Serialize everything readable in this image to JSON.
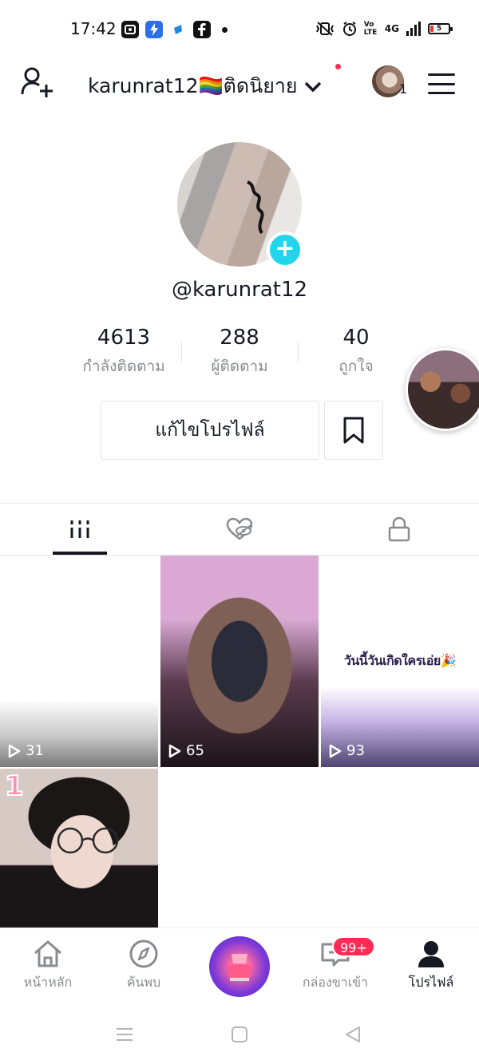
{
  "status_bar": {
    "time": "17:42",
    "left_icons": [
      "screen-record-icon",
      "lightning-app-icon",
      "shield-app-icon",
      "facebook-icon",
      "dot-icon"
    ],
    "right_icons": [
      "vibrate-icon",
      "alarm-icon",
      "volte-icon",
      "4g-signal-icon",
      "battery-icon"
    ],
    "volte_text": "Vo LTE",
    "network_text": "4G",
    "battery_level": "5"
  },
  "header": {
    "username": "karunrat12🏳️‍🌈ติดนิยาย",
    "account_count": "1"
  },
  "profile": {
    "handle": "@karunrat12",
    "stats": [
      {
        "value": "4613",
        "label": "กำลังติดตาม"
      },
      {
        "value": "288",
        "label": "ผู้ติดตาม"
      },
      {
        "value": "40",
        "label": "ถูกใจ"
      }
    ],
    "edit_profile_label": "แก้ไขโปรไฟล์"
  },
  "tabs": [
    "videos-grid-icon",
    "liked-icon",
    "private-lock-icon"
  ],
  "videos": [
    {
      "plays": "31"
    },
    {
      "plays": "65"
    },
    {
      "plays": "93",
      "caption": "วันนี้วันเกิดใครเอ่ย🎉"
    },
    {
      "badge": "1"
    }
  ],
  "bottom_nav": {
    "items": [
      {
        "label": "หน้าหลัก",
        "icon": "home-icon"
      },
      {
        "label": "ค้นพบ",
        "icon": "compass-icon"
      },
      {
        "label": "",
        "icon": "create-icon"
      },
      {
        "label": "กล่องขาเข้า",
        "icon": "inbox-icon"
      },
      {
        "label": "โปรไฟล์",
        "icon": "profile-icon"
      }
    ],
    "inbox_badge": "99+"
  },
  "colors": {
    "accent_cyan": "#20d5ec",
    "badge_red": "#fe2c55",
    "text_primary": "#161823",
    "text_secondary": "#8a8b91"
  }
}
